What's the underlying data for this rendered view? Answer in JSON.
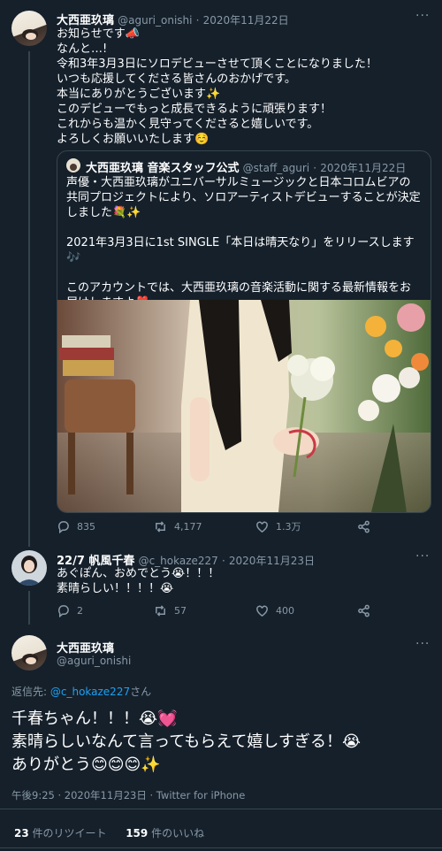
{
  "tweet1": {
    "name": "大西亜玖璃",
    "handle": "@aguri_onishi",
    "sep": "·",
    "date": "2020年11月22日",
    "more": "···",
    "text": "お知らせです📣\nなんと…!\n令和3年3月3日にソロデビューさせて頂くことになりました！\nいつも応援してくださる皆さんのおかげです。\n本当にありがとうございます✨\nこのデビューでもっと成長できるように頑張ります！\nこれからも温かく見守ってくださると嬉しいです。\nよろしくお願いいたします☺️",
    "quote": {
      "name": "大西亜玖璃 音楽スタッフ公式",
      "handle": "@staff_aguri",
      "sep": "·",
      "date": "2020年11月22日",
      "text": "声優・大西亜玖璃がユニバーサルミュージックと日本コロムビアの共同プロジェクトにより、ソロアーティストデビューすることが決定しました💐✨\n\n2021年3月3日に1st SINGLE「本日は晴天なり」をリリースします🎶\n\nこのアカウントでは、大西亜玖璃の音楽活動に関する最新情報をお届けしますよ❣️"
    },
    "replies": "835",
    "retweets": "4,177",
    "likes": "1.3万"
  },
  "tweet2": {
    "name": "22/7 帆風千春",
    "handle": "@c_hokaze227",
    "sep": "·",
    "date": "2020年11月23日",
    "more": "···",
    "text": "あぐぽん、おめでとう😭！！！\n素晴らしい！！！！😭",
    "replies": "2",
    "retweets": "57",
    "likes": "400"
  },
  "main": {
    "name": "大西亜玖璃",
    "handle": "@aguri_onishi",
    "more": "···",
    "reply_prefix": "返信先: ",
    "reply_to": "@c_hokaze227",
    "reply_suffix": "さん",
    "text": "千春ちゃん！！！😭💓\n素晴らしいなんて言ってもらえて嬉しすぎる！😭\nありがとう😊😊😊✨",
    "meta": "午後9:25 · 2020年11月23日 · Twitter for iPhone",
    "rt_count": "23",
    "rt_label": "件のリツイート",
    "like_count": "159",
    "like_label": "件のいいね"
  }
}
